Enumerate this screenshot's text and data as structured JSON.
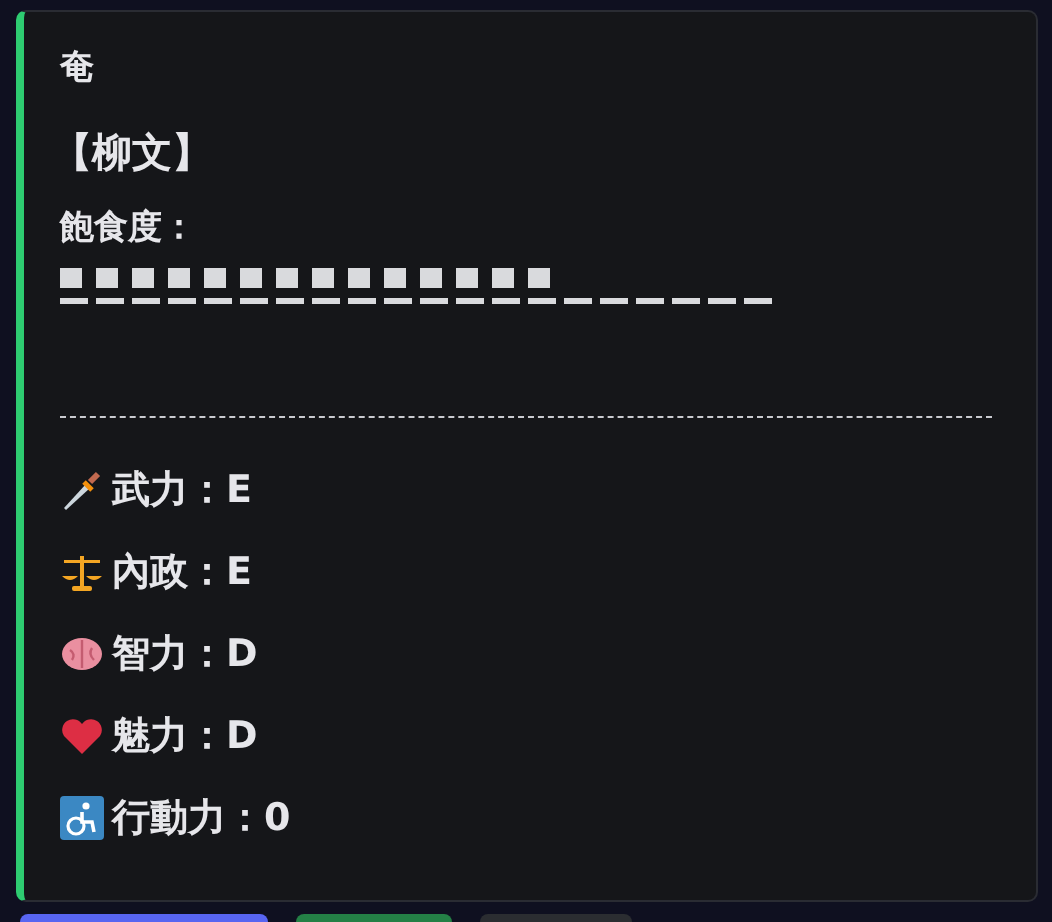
{
  "embed": {
    "author": "奄",
    "name": "【柳文】",
    "hunger_label": "飽食度：",
    "hunger": {
      "level": 0.7
    },
    "stats": [
      {
        "text": "武力：E"
      },
      {
        "text": "內政：E"
      },
      {
        "text": "智力：D"
      },
      {
        "text": "魅力：D"
      },
      {
        "text": "行動力：0"
      }
    ]
  },
  "buttons": [
    {
      "kind": "primary"
    },
    {
      "kind": "success"
    },
    {
      "kind": "secondary"
    }
  ]
}
